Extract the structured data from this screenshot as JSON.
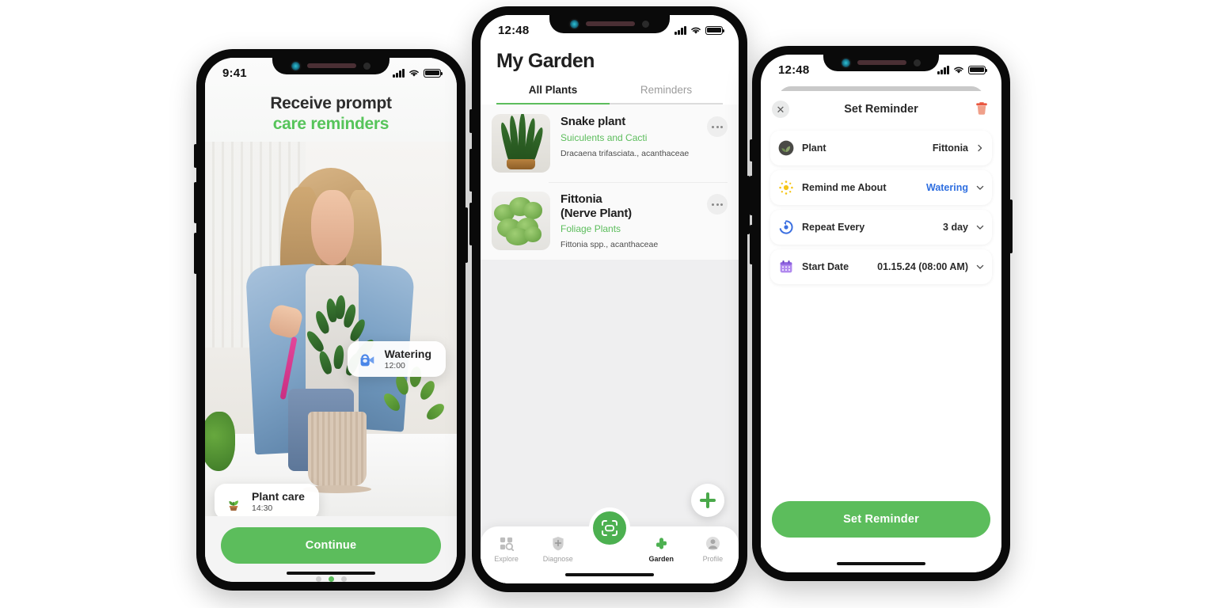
{
  "page": {
    "background": "#ffffff",
    "accent_green": "#5cbd5c",
    "accent_blue": "#2f6fe0"
  },
  "phone1": {
    "name": "onboarding-screen",
    "status_bar": {
      "time": "9:41",
      "signal_icon": "cellular-signal-icon",
      "wifi_icon": "wifi-icon",
      "battery_icon": "battery-icon"
    },
    "headline_line1": "Receive prompt",
    "headline_line2": "care reminders",
    "toasts": [
      {
        "icon": "watering-can-icon",
        "title": "Watering",
        "time": "12:00"
      },
      {
        "icon": "potted-seedling-icon",
        "title": "Plant care",
        "time": "14:30"
      }
    ],
    "cta_label": "Continue",
    "pager": {
      "total": 3,
      "active_index": 1
    }
  },
  "phone2": {
    "name": "my-garden-screen",
    "status_bar": {
      "time": "12:48",
      "signal_icon": "cellular-signal-icon",
      "wifi_icon": "wifi-icon",
      "battery_icon": "battery-icon"
    },
    "title": "My Garden",
    "tabs": [
      {
        "label": "All Plants",
        "active": true
      },
      {
        "label": "Reminders",
        "active": false
      }
    ],
    "plants": [
      {
        "thumb": "snake-plant-thumbnail",
        "name": "Snake plant",
        "category": "Suiculents and Cacti",
        "scientific": "Dracaena trifasciata., acanthaceae",
        "menu_icon": "more-options-icon"
      },
      {
        "thumb": "fittonia-thumbnail",
        "name": "Fittonia\n(Nerve Plant)",
        "name_line1": "Fittonia",
        "name_line2": "(Nerve Plant)",
        "category": "Foliage Plants",
        "scientific": "Fittonia spp., acanthaceae",
        "menu_icon": "more-options-icon"
      }
    ],
    "fab": {
      "icon": "plus-icon",
      "label": ""
    },
    "scan_button": {
      "icon": "scan-icon"
    },
    "tabbar": [
      {
        "icon": "explore-grid-search-icon",
        "label": "Explore",
        "active": false
      },
      {
        "icon": "diagnose-shield-icon",
        "label": "Diagnose",
        "active": false
      },
      {
        "icon": "cactus-icon",
        "label": "Garden",
        "active": true
      },
      {
        "icon": "profile-avatar-icon",
        "label": "Profile",
        "active": false
      }
    ]
  },
  "phone3": {
    "name": "set-reminder-sheet",
    "status_bar": {
      "time": "12:48",
      "signal_icon": "cellular-signal-icon",
      "wifi_icon": "wifi-icon",
      "battery_icon": "battery-icon"
    },
    "close_icon": "close-icon",
    "header_title": "Set Reminder",
    "delete_icon": "trash-icon",
    "rows": [
      {
        "icon": "plant-avatar-icon",
        "label": "Plant",
        "value": "Fittonia",
        "affordance": "chevron-right-icon"
      },
      {
        "icon": "sun-sparkle-icon",
        "label": "Remind me About",
        "value": "Watering",
        "value_color": "#2f6fe0",
        "affordance": "chevron-down-icon"
      },
      {
        "icon": "repeat-circle-icon",
        "label": "Repeat Every",
        "value": "3 day",
        "affordance": "chevron-down-icon"
      },
      {
        "icon": "calendar-icon",
        "label": "Start Date",
        "value": "01.15.24 (08:00 AM)",
        "affordance": "chevron-down-icon"
      }
    ],
    "cta_label": "Set Reminder"
  }
}
